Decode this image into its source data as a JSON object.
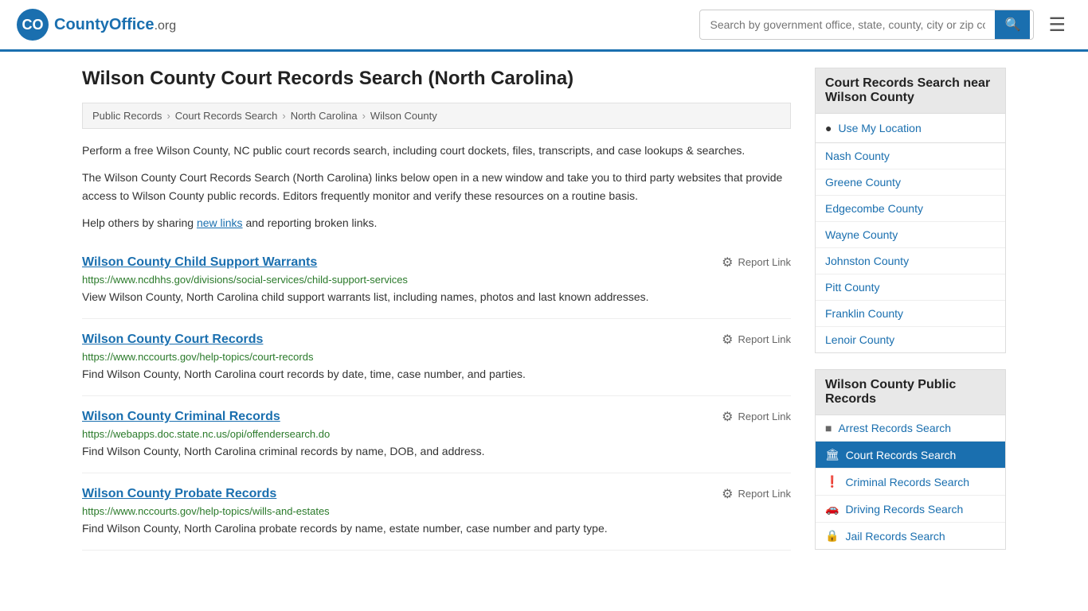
{
  "header": {
    "logo_text": "CountyOffice",
    "logo_suffix": ".org",
    "search_placeholder": "Search by government office, state, county, city or zip code",
    "search_value": ""
  },
  "page": {
    "title": "Wilson County Court Records Search (North Carolina)",
    "breadcrumbs": [
      {
        "label": "Public Records",
        "href": "#"
      },
      {
        "label": "Court Records Search",
        "href": "#"
      },
      {
        "label": "North Carolina",
        "href": "#"
      },
      {
        "label": "Wilson County",
        "href": "#"
      }
    ],
    "description1": "Perform a free Wilson County, NC public court records search, including court dockets, files, transcripts, and case lookups & searches.",
    "description2": "The Wilson County Court Records Search (North Carolina) links below open in a new window and take you to third party websites that provide access to Wilson County public records. Editors frequently monitor and verify these resources on a routine basis.",
    "description3_prefix": "Help others by sharing ",
    "description3_link": "new links",
    "description3_suffix": " and reporting broken links.",
    "records": [
      {
        "title": "Wilson County Child Support Warrants",
        "url": "https://www.ncdhhs.gov/divisions/social-services/child-support-services",
        "description": "View Wilson County, North Carolina child support warrants list, including names, photos and last known addresses.",
        "report_label": "Report Link"
      },
      {
        "title": "Wilson County Court Records",
        "url": "https://www.nccourts.gov/help-topics/court-records",
        "description": "Find Wilson County, North Carolina court records by date, time, case number, and parties.",
        "report_label": "Report Link"
      },
      {
        "title": "Wilson County Criminal Records",
        "url": "https://webapps.doc.state.nc.us/opi/offendersearch.do",
        "description": "Find Wilson County, North Carolina criminal records by name, DOB, and address.",
        "report_label": "Report Link"
      },
      {
        "title": "Wilson County Probate Records",
        "url": "https://www.nccourts.gov/help-topics/wills-and-estates",
        "description": "Find Wilson County, North Carolina probate records by name, estate number, case number and party type.",
        "report_label": "Report Link"
      }
    ]
  },
  "sidebar": {
    "nearby_title": "Court Records Search near Wilson County",
    "use_location_label": "Use My Location",
    "nearby_counties": [
      {
        "label": "Nash County"
      },
      {
        "label": "Greene County"
      },
      {
        "label": "Edgecombe County"
      },
      {
        "label": "Wayne County"
      },
      {
        "label": "Johnston County"
      },
      {
        "label": "Pitt County"
      },
      {
        "label": "Franklin County"
      },
      {
        "label": "Lenoir County"
      }
    ],
    "public_records_title": "Wilson County Public Records",
    "public_records_items": [
      {
        "label": "Arrest Records Search",
        "icon": "■",
        "active": false
      },
      {
        "label": "Court Records Search",
        "icon": "🏛",
        "active": true
      },
      {
        "label": "Criminal Records Search",
        "icon": "❗",
        "active": false
      },
      {
        "label": "Driving Records Search",
        "icon": "🚗",
        "active": false
      },
      {
        "label": "Jail Records Search",
        "icon": "🔒",
        "active": false
      }
    ]
  }
}
